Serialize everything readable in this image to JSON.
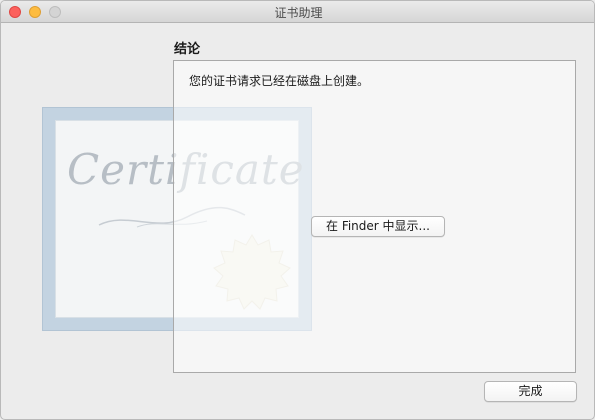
{
  "window": {
    "title": "证书助理",
    "traffic_lights": {
      "close": "#fc615d",
      "minimize": "#fdbc40",
      "zoom": "#d4d4d4"
    }
  },
  "background_image": {
    "icon": "certificate-image",
    "script_text": "Certificate"
  },
  "content": {
    "heading": "结论",
    "message": "您的证书请求已经在磁盘上创建。",
    "show_in_finder_button": "在 Finder 中显示..."
  },
  "footer": {
    "done_button": "完成"
  }
}
